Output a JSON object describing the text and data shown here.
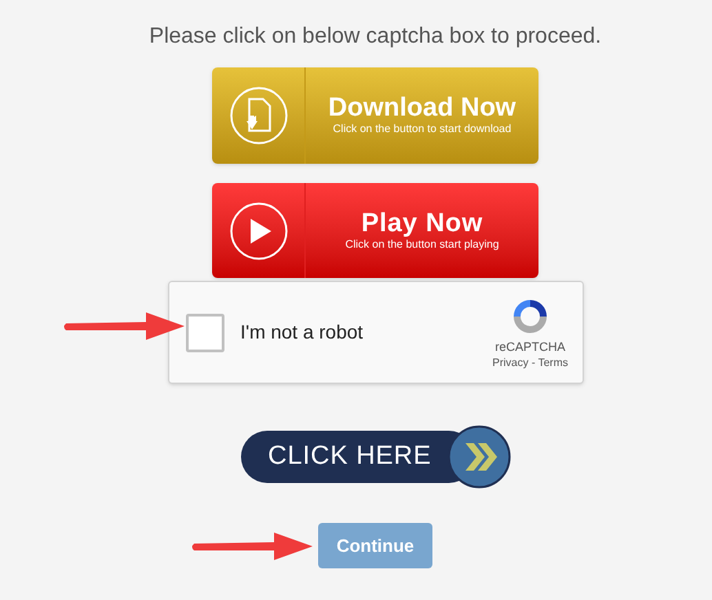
{
  "heading": "Please click on below captcha box to proceed.",
  "download_button": {
    "title": "Download Now",
    "subtitle": "Click on the button to start download"
  },
  "play_button": {
    "title": "Play Now",
    "subtitle": "Click on the button start playing"
  },
  "recaptcha": {
    "label": "I'm not a robot",
    "checked": false,
    "brand": "reCAPTCHA",
    "links": "Privacy - Terms"
  },
  "click_here_button": {
    "label": "CLICK HERE"
  },
  "continue_button": {
    "label": "Continue"
  }
}
